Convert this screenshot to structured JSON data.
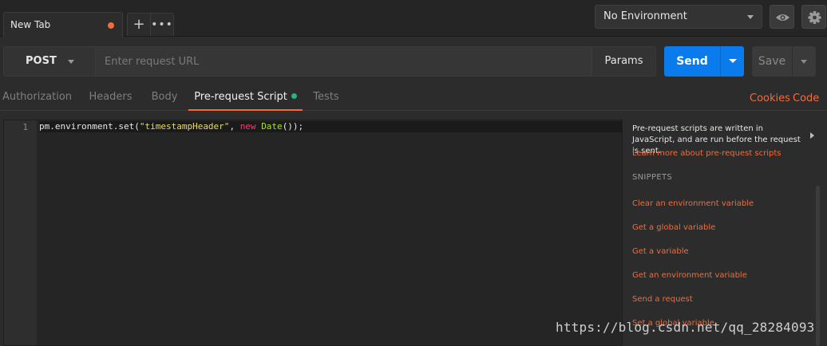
{
  "tabs": {
    "active_tab_label": "New Tab",
    "new_tab_symbol": "+",
    "more_symbol": "•••"
  },
  "environment": {
    "selected": "No Environment"
  },
  "request": {
    "method": "POST",
    "url_placeholder": "Enter request URL",
    "params_label": "Params",
    "send_label": "Send",
    "save_label": "Save"
  },
  "subtabs": {
    "items": [
      "Authorization",
      "Headers",
      "Body",
      "Pre-request Script",
      "Tests"
    ],
    "active": "Pre-request Script",
    "cookies_label": "Cookies",
    "code_label": "Code"
  },
  "editor": {
    "line_number": "1",
    "code_tokens": {
      "t1": "pm.environment.set(",
      "t2": "\"timestampHeader\"",
      "t3": ", ",
      "t4": "new",
      "t5": " ",
      "t6": "Date",
      "t7": "());"
    }
  },
  "panel": {
    "description": "Pre-request scripts are written in JavaScript, and are run before the request is sent.",
    "learn_more": "Learn more about pre-request scripts",
    "snippets_title": "SNIPPETS",
    "snippets": [
      "Clear an environment variable",
      "Get a global variable",
      "Get a variable",
      "Get an environment variable",
      "Send a request",
      "Set a global variable"
    ]
  },
  "watermark": "https://blog.csdn.net/qq_28284093",
  "colors": {
    "accent": "#f26b3a",
    "send_blue": "#097bed",
    "active_dot_green": "#26b47f"
  }
}
